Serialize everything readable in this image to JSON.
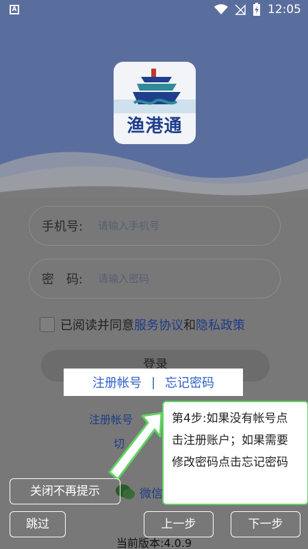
{
  "status_bar": {
    "notification_icon": "A",
    "time": "12:05"
  },
  "app": {
    "logo_text": "渔港通"
  },
  "form": {
    "phone_label": "手机号:",
    "phone_placeholder": "请输入手机号",
    "password_label": "密　码:",
    "password_placeholder": "请输入密码",
    "agree_prefix": "已阅读并同意",
    "service_agreement": "服务协议",
    "and": "和",
    "privacy_policy": "隐私政策",
    "login_label": "登录"
  },
  "background_links": {
    "register": "注册帐号",
    "switch": "切"
  },
  "guide": {
    "highlight_register": "注册帐号",
    "highlight_separator": "|",
    "highlight_forgot": "忘记密码",
    "tip_text": "第4步:如果没有帐号点击注册账户；如果需要修改密码点击忘记密码",
    "close_label": "关闭不再提示",
    "skip_label": "跳过",
    "prev_label": "上一步",
    "next_label": "下一步"
  },
  "wechat": {
    "label": "微信"
  },
  "footer": {
    "version": "当前版本:4.0.9"
  },
  "colors": {
    "header_blue": "#5a6e9e",
    "link_blue": "#2d5fc7",
    "tip_border": "#5fd35f"
  }
}
